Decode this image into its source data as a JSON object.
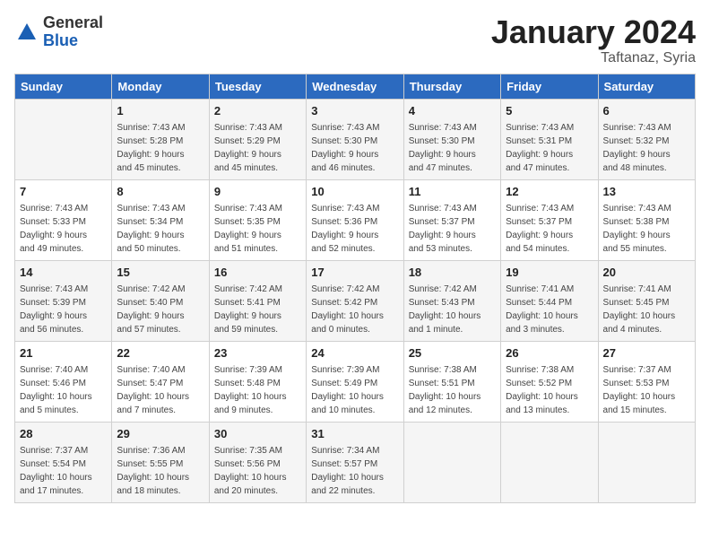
{
  "header": {
    "logo_general": "General",
    "logo_blue": "Blue",
    "month_title": "January 2024",
    "subtitle": "Taftanaz, Syria"
  },
  "calendar": {
    "weekdays": [
      "Sunday",
      "Monday",
      "Tuesday",
      "Wednesday",
      "Thursday",
      "Friday",
      "Saturday"
    ],
    "weeks": [
      [
        {
          "day": "",
          "content": ""
        },
        {
          "day": "1",
          "content": "Sunrise: 7:43 AM\nSunset: 5:28 PM\nDaylight: 9 hours\nand 45 minutes."
        },
        {
          "day": "2",
          "content": "Sunrise: 7:43 AM\nSunset: 5:29 PM\nDaylight: 9 hours\nand 45 minutes."
        },
        {
          "day": "3",
          "content": "Sunrise: 7:43 AM\nSunset: 5:30 PM\nDaylight: 9 hours\nand 46 minutes."
        },
        {
          "day": "4",
          "content": "Sunrise: 7:43 AM\nSunset: 5:30 PM\nDaylight: 9 hours\nand 47 minutes."
        },
        {
          "day": "5",
          "content": "Sunrise: 7:43 AM\nSunset: 5:31 PM\nDaylight: 9 hours\nand 47 minutes."
        },
        {
          "day": "6",
          "content": "Sunrise: 7:43 AM\nSunset: 5:32 PM\nDaylight: 9 hours\nand 48 minutes."
        }
      ],
      [
        {
          "day": "7",
          "content": "Sunrise: 7:43 AM\nSunset: 5:33 PM\nDaylight: 9 hours\nand 49 minutes."
        },
        {
          "day": "8",
          "content": "Sunrise: 7:43 AM\nSunset: 5:34 PM\nDaylight: 9 hours\nand 50 minutes."
        },
        {
          "day": "9",
          "content": "Sunrise: 7:43 AM\nSunset: 5:35 PM\nDaylight: 9 hours\nand 51 minutes."
        },
        {
          "day": "10",
          "content": "Sunrise: 7:43 AM\nSunset: 5:36 PM\nDaylight: 9 hours\nand 52 minutes."
        },
        {
          "day": "11",
          "content": "Sunrise: 7:43 AM\nSunset: 5:37 PM\nDaylight: 9 hours\nand 53 minutes."
        },
        {
          "day": "12",
          "content": "Sunrise: 7:43 AM\nSunset: 5:37 PM\nDaylight: 9 hours\nand 54 minutes."
        },
        {
          "day": "13",
          "content": "Sunrise: 7:43 AM\nSunset: 5:38 PM\nDaylight: 9 hours\nand 55 minutes."
        }
      ],
      [
        {
          "day": "14",
          "content": "Sunrise: 7:43 AM\nSunset: 5:39 PM\nDaylight: 9 hours\nand 56 minutes."
        },
        {
          "day": "15",
          "content": "Sunrise: 7:42 AM\nSunset: 5:40 PM\nDaylight: 9 hours\nand 57 minutes."
        },
        {
          "day": "16",
          "content": "Sunrise: 7:42 AM\nSunset: 5:41 PM\nDaylight: 9 hours\nand 59 minutes."
        },
        {
          "day": "17",
          "content": "Sunrise: 7:42 AM\nSunset: 5:42 PM\nDaylight: 10 hours\nand 0 minutes."
        },
        {
          "day": "18",
          "content": "Sunrise: 7:42 AM\nSunset: 5:43 PM\nDaylight: 10 hours\nand 1 minute."
        },
        {
          "day": "19",
          "content": "Sunrise: 7:41 AM\nSunset: 5:44 PM\nDaylight: 10 hours\nand 3 minutes."
        },
        {
          "day": "20",
          "content": "Sunrise: 7:41 AM\nSunset: 5:45 PM\nDaylight: 10 hours\nand 4 minutes."
        }
      ],
      [
        {
          "day": "21",
          "content": "Sunrise: 7:40 AM\nSunset: 5:46 PM\nDaylight: 10 hours\nand 5 minutes."
        },
        {
          "day": "22",
          "content": "Sunrise: 7:40 AM\nSunset: 5:47 PM\nDaylight: 10 hours\nand 7 minutes."
        },
        {
          "day": "23",
          "content": "Sunrise: 7:39 AM\nSunset: 5:48 PM\nDaylight: 10 hours\nand 9 minutes."
        },
        {
          "day": "24",
          "content": "Sunrise: 7:39 AM\nSunset: 5:49 PM\nDaylight: 10 hours\nand 10 minutes."
        },
        {
          "day": "25",
          "content": "Sunrise: 7:38 AM\nSunset: 5:51 PM\nDaylight: 10 hours\nand 12 minutes."
        },
        {
          "day": "26",
          "content": "Sunrise: 7:38 AM\nSunset: 5:52 PM\nDaylight: 10 hours\nand 13 minutes."
        },
        {
          "day": "27",
          "content": "Sunrise: 7:37 AM\nSunset: 5:53 PM\nDaylight: 10 hours\nand 15 minutes."
        }
      ],
      [
        {
          "day": "28",
          "content": "Sunrise: 7:37 AM\nSunset: 5:54 PM\nDaylight: 10 hours\nand 17 minutes."
        },
        {
          "day": "29",
          "content": "Sunrise: 7:36 AM\nSunset: 5:55 PM\nDaylight: 10 hours\nand 18 minutes."
        },
        {
          "day": "30",
          "content": "Sunrise: 7:35 AM\nSunset: 5:56 PM\nDaylight: 10 hours\nand 20 minutes."
        },
        {
          "day": "31",
          "content": "Sunrise: 7:34 AM\nSunset: 5:57 PM\nDaylight: 10 hours\nand 22 minutes."
        },
        {
          "day": "",
          "content": ""
        },
        {
          "day": "",
          "content": ""
        },
        {
          "day": "",
          "content": ""
        }
      ]
    ]
  }
}
